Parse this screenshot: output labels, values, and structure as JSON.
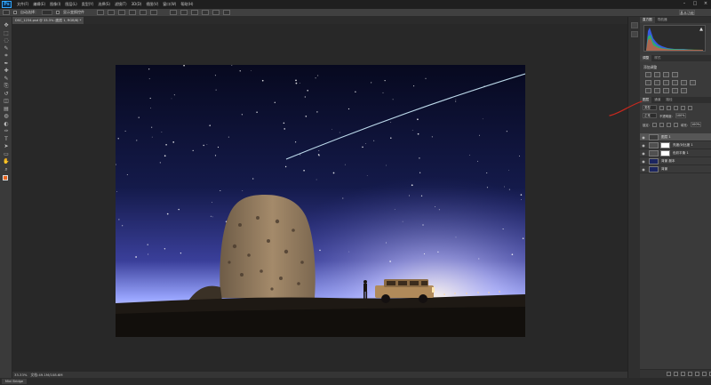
{
  "app": {
    "logo": "Ps",
    "menus": [
      "文件(F)",
      "编辑(E)",
      "图像(I)",
      "图层(L)",
      "类型(Y)",
      "选择(S)",
      "滤镜(T)",
      "3D(D)",
      "视图(V)",
      "窗口(W)",
      "帮助(H)"
    ],
    "window_controls": [
      "–",
      "□",
      "×"
    ]
  },
  "options_bar": {
    "auto_select_label": "自动选择：",
    "show_transform_label": "显示变换控件",
    "workspace_label": "基本功能"
  },
  "document": {
    "tab_title": "DSC_1234.psd @ 33.3% (图层 1, RGB/8) *"
  },
  "status_bar": {
    "zoom": "33.33%",
    "doc_info": "文档:49.1M/108.6M",
    "mini_tab": "Mini Bridge"
  },
  "panels": {
    "top_tabs": [
      {
        "label": "直方图",
        "active": true
      },
      {
        "label": "导航器",
        "active": false
      }
    ],
    "middle_tabs": [
      {
        "label": "调整",
        "active": true
      },
      {
        "label": "样式",
        "active": false
      }
    ],
    "adjust_title": "添加调整",
    "layers_tabs": [
      {
        "label": "图层",
        "active": true
      },
      {
        "label": "通道",
        "active": false
      },
      {
        "label": "路径",
        "active": false
      }
    ],
    "blend_mode": "正常",
    "opacity_label": "不透明度:",
    "opacity_value": "100%",
    "lock_label": "锁定:",
    "fill_label": "填充:",
    "fill_value": "100%",
    "kind_label": "类型"
  },
  "layers": [
    {
      "name": "图层 1",
      "selected": true,
      "thumb": "#3c3c3c",
      "mask": false
    },
    {
      "name": "亮度/对比度 1",
      "selected": false,
      "thumb": "#505050",
      "mask": true
    },
    {
      "name": "色彩平衡 1",
      "selected": false,
      "thumb": "#505050",
      "mask": true
    },
    {
      "name": "背景 副本",
      "selected": false,
      "thumb": "#1c2660",
      "mask": false
    },
    {
      "name": "背景",
      "selected": false,
      "thumb": "#1c2660",
      "mask": false
    }
  ],
  "colors": {
    "foreground": "#e8641e",
    "background": "#ffffff",
    "annotation": "#c8281e",
    "sky_top": "#07091f",
    "sky_horizon": "#9aa6ff"
  },
  "icons": {
    "tools": [
      "move-tool-icon",
      "marquee-tool-icon",
      "lasso-tool-icon",
      "quick-select-tool-icon",
      "crop-tool-icon",
      "eyedropper-tool-icon",
      "healing-brush-tool-icon",
      "brush-tool-icon",
      "clone-stamp-tool-icon",
      "history-brush-tool-icon",
      "eraser-tool-icon",
      "gradient-tool-icon",
      "blur-tool-icon",
      "dodge-tool-icon",
      "pen-tool-icon",
      "type-tool-icon",
      "path-select-tool-icon",
      "shape-tool-icon",
      "hand-tool-icon",
      "zoom-tool-icon"
    ]
  }
}
